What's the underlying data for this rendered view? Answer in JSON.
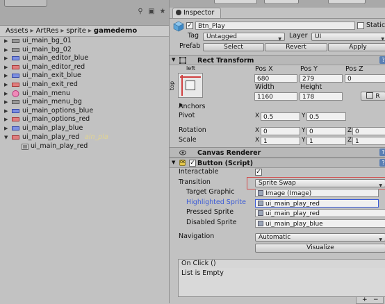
{
  "project": {
    "breadcrumb": [
      "Assets",
      "ArtRes",
      "sprite",
      "gamedemo"
    ],
    "toolbar_icons": [
      "filter-icon",
      "lock-icon",
      "star-icon"
    ],
    "files": [
      {
        "label": "ui_main_bg_01",
        "icon": "sprite-icon-grey"
      },
      {
        "label": "ui_main_bg_02",
        "icon": "sprite-icon-grey"
      },
      {
        "label": "ui_main_editor_blue",
        "icon": "sprite-icon-blue"
      },
      {
        "label": "ui_main_editor_red",
        "icon": "sprite-icon-red"
      },
      {
        "label": "ui_main_exit_blue",
        "icon": "sprite-icon-blue"
      },
      {
        "label": "ui_main_exit_red",
        "icon": "sprite-icon-red"
      },
      {
        "label": "ui_main_menu",
        "icon": "sprite-icon-pink"
      },
      {
        "label": "ui_main_menu_bg",
        "icon": "sprite-icon-grey"
      },
      {
        "label": "ui_main_options_blue",
        "icon": "sprite-icon-blue"
      },
      {
        "label": "ui_main_options_red",
        "icon": "sprite-icon-red"
      },
      {
        "label": "ui_main_play_blue",
        "icon": "sprite-icon-blue"
      },
      {
        "label": "ui_main_play_red",
        "icon": "sprite-icon-red"
      }
    ],
    "drag_ghost": "ain_pla",
    "child_item": "ui_main_play_red"
  },
  "inspector": {
    "tab_label": "Inspector",
    "object_name": "Btn_Play",
    "static_label": "Static",
    "tag_label": "Tag",
    "tag_value": "Untagged",
    "layer_label": "Layer",
    "layer_value": "UI",
    "prefab_label": "Prefab",
    "prefab_buttons": [
      "Select",
      "Revert",
      "Apply"
    ],
    "rect_transform": {
      "title": "Rect Transform",
      "anchor_h": "left",
      "anchor_v": "top",
      "pos_x_label": "Pos X",
      "pos_y_label": "Pos Y",
      "pos_z_label": "Pos Z",
      "pos_x": "680",
      "pos_y": "279",
      "pos_z": "0",
      "width_label": "Width",
      "height_label": "Height",
      "width": "1160",
      "height": "178",
      "r_button": "R",
      "anchors_label": "Anchors",
      "pivot_label": "Pivot",
      "pivot_x": "0.5",
      "pivot_y": "0.5",
      "rotation_label": "Rotation",
      "rot_x": "0",
      "rot_y": "0",
      "rot_z": "0",
      "scale_label": "Scale",
      "scale_x": "1",
      "scale_y": "1",
      "scale_z": "1",
      "x_axis": "X",
      "y_axis": "Y",
      "z_axis": "Z"
    },
    "canvas_renderer": {
      "title": "Canvas Renderer"
    },
    "button_script": {
      "title": "Button (Script)",
      "interactable_label": "Interactable",
      "interactable_checked": "✓",
      "transition_label": "Transition",
      "transition_value": "Sprite Swap",
      "target_graphic_label": "Target Graphic",
      "target_graphic_value": "Image (Image)",
      "highlighted_label": "Highlighted Sprite",
      "highlighted_value": "ui_main_play_red",
      "pressed_label": "Pressed Sprite",
      "pressed_value": "ui_main_play_red",
      "disabled_label": "Disabled Sprite",
      "disabled_value": "ui_main_play_blue",
      "navigation_label": "Navigation",
      "navigation_value": "Automatic",
      "visualize_label": "Visualize",
      "onclick_label": "On Click ()",
      "list_empty": "List is Empty",
      "plus_label": "+",
      "minus_label": "−"
    }
  },
  "colors": {
    "highlight_label": "#3b5bd6",
    "red_outline": "#d24a4a"
  }
}
